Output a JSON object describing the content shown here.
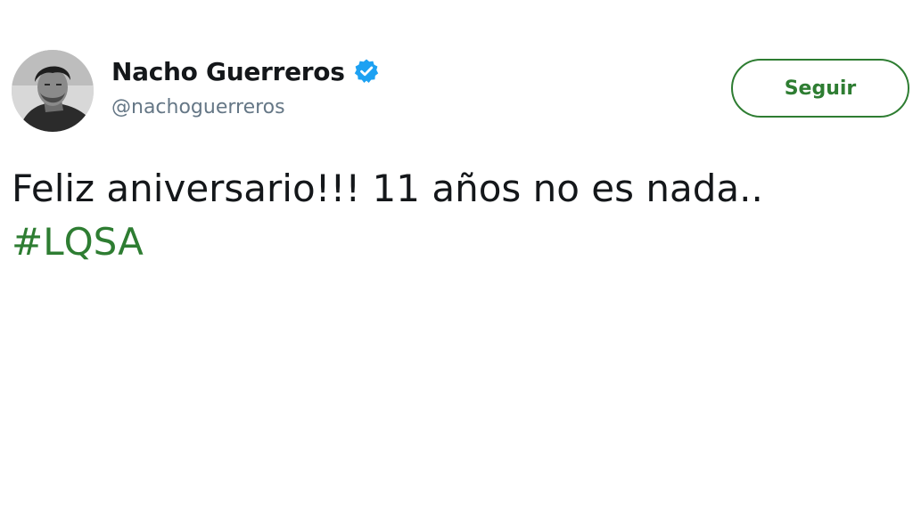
{
  "author": {
    "display_name": "Nacho Guerreros",
    "handle": "@nachoguerreros",
    "verified_icon": "verified-badge-icon",
    "avatar_icon": "avatar"
  },
  "follow_button": {
    "label": "Seguir"
  },
  "tweet": {
    "text": "Feliz aniversario!!! 11 años no es nada..",
    "hashtag": "#LQSA"
  },
  "colors": {
    "accent": "#2e7d32",
    "verified": "#1da1f2",
    "text": "#14171a",
    "muted": "#657786"
  }
}
